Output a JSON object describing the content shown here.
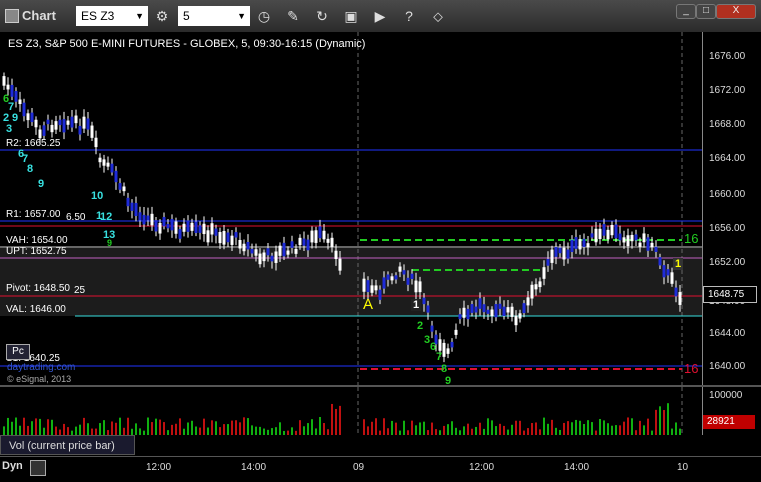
{
  "window": {
    "title": "Chart",
    "minimize": "_",
    "maximize": "□",
    "close": "X"
  },
  "toolbar": {
    "symbol": "ES Z3",
    "interval": "5",
    "icons": [
      "settings-icon",
      "clock-icon",
      "pencil-icon",
      "refresh-icon",
      "get-icon",
      "play-icon",
      "help-icon",
      "link-icon"
    ]
  },
  "chart": {
    "title": "ES Z3, S&P 500 E-MINI FUTURES - GLOBEX, 5, 09:30-16:15 (Dynamic)",
    "current_price": "1648.75",
    "price_ticks": [
      "1676.00",
      "1672.00",
      "1668.00",
      "1664.00",
      "1660.00",
      "1656.00",
      "1652.00",
      "1648.00",
      "1644.00",
      "1640.00"
    ],
    "levels": {
      "r2": "R2: 1665.25",
      "r1": "R1: 1657.00",
      "r1b": "6.50",
      "vah": "VAH: 1654.00",
      "upt": "UPT: 1652.75",
      "pivot": "Pivot: 1648.50",
      "pivot_b": "25",
      "val": "VAL: 1646.00",
      "s1": "S1: 1640.25"
    },
    "marker_a": "A",
    "pc_label": "Pc",
    "watermark": "© eSignal, 2013",
    "watermark_site": "daytrading.com",
    "line_label_16_green": "16",
    "line_label_16_red": "16",
    "seq_labels": {
      "s6": "6",
      "s7": "7",
      "s2": "2",
      "s9a": "9",
      "s3": "3",
      "s6b": "6",
      "s7b": "7",
      "s8": "8",
      "s9": "9",
      "s10": "10",
      "s1a": "1",
      "s12": "12",
      "s13": "13",
      "s9c": "9",
      "s1b": "1",
      "s2b": "2",
      "s3b": "3",
      "s6c": "6",
      "s7c": "7",
      "s8b": "8",
      "s9b": "9",
      "s1c": "1"
    },
    "colors": {
      "up": "#1e2bd9",
      "wick": "#ffffff",
      "green": "#22cc22",
      "red": "#e01030",
      "yellow": "#ffff00",
      "cyan": "#38e0e0"
    }
  },
  "volume": {
    "label": "Vol (current price bar)",
    "axis_top": "100000",
    "current": "28921"
  },
  "time_axis": {
    "mode": "Dyn",
    "labels": [
      "12:00",
      "14:00",
      "09",
      "12:00",
      "14:00",
      "10"
    ]
  }
}
